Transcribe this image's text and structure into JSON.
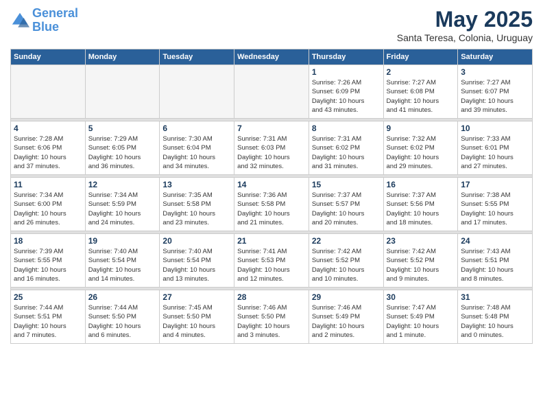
{
  "logo": {
    "line1": "General",
    "line2": "Blue"
  },
  "title": "May 2025",
  "location": "Santa Teresa, Colonia, Uruguay",
  "weekdays": [
    "Sunday",
    "Monday",
    "Tuesday",
    "Wednesday",
    "Thursday",
    "Friday",
    "Saturday"
  ],
  "weeks": [
    [
      {
        "day": "",
        "info": ""
      },
      {
        "day": "",
        "info": ""
      },
      {
        "day": "",
        "info": ""
      },
      {
        "day": "",
        "info": ""
      },
      {
        "day": "1",
        "info": "Sunrise: 7:26 AM\nSunset: 6:09 PM\nDaylight: 10 hours\nand 43 minutes."
      },
      {
        "day": "2",
        "info": "Sunrise: 7:27 AM\nSunset: 6:08 PM\nDaylight: 10 hours\nand 41 minutes."
      },
      {
        "day": "3",
        "info": "Sunrise: 7:27 AM\nSunset: 6:07 PM\nDaylight: 10 hours\nand 39 minutes."
      }
    ],
    [
      {
        "day": "4",
        "info": "Sunrise: 7:28 AM\nSunset: 6:06 PM\nDaylight: 10 hours\nand 37 minutes."
      },
      {
        "day": "5",
        "info": "Sunrise: 7:29 AM\nSunset: 6:05 PM\nDaylight: 10 hours\nand 36 minutes."
      },
      {
        "day": "6",
        "info": "Sunrise: 7:30 AM\nSunset: 6:04 PM\nDaylight: 10 hours\nand 34 minutes."
      },
      {
        "day": "7",
        "info": "Sunrise: 7:31 AM\nSunset: 6:03 PM\nDaylight: 10 hours\nand 32 minutes."
      },
      {
        "day": "8",
        "info": "Sunrise: 7:31 AM\nSunset: 6:02 PM\nDaylight: 10 hours\nand 31 minutes."
      },
      {
        "day": "9",
        "info": "Sunrise: 7:32 AM\nSunset: 6:02 PM\nDaylight: 10 hours\nand 29 minutes."
      },
      {
        "day": "10",
        "info": "Sunrise: 7:33 AM\nSunset: 6:01 PM\nDaylight: 10 hours\nand 27 minutes."
      }
    ],
    [
      {
        "day": "11",
        "info": "Sunrise: 7:34 AM\nSunset: 6:00 PM\nDaylight: 10 hours\nand 26 minutes."
      },
      {
        "day": "12",
        "info": "Sunrise: 7:34 AM\nSunset: 5:59 PM\nDaylight: 10 hours\nand 24 minutes."
      },
      {
        "day": "13",
        "info": "Sunrise: 7:35 AM\nSunset: 5:58 PM\nDaylight: 10 hours\nand 23 minutes."
      },
      {
        "day": "14",
        "info": "Sunrise: 7:36 AM\nSunset: 5:58 PM\nDaylight: 10 hours\nand 21 minutes."
      },
      {
        "day": "15",
        "info": "Sunrise: 7:37 AM\nSunset: 5:57 PM\nDaylight: 10 hours\nand 20 minutes."
      },
      {
        "day": "16",
        "info": "Sunrise: 7:37 AM\nSunset: 5:56 PM\nDaylight: 10 hours\nand 18 minutes."
      },
      {
        "day": "17",
        "info": "Sunrise: 7:38 AM\nSunset: 5:55 PM\nDaylight: 10 hours\nand 17 minutes."
      }
    ],
    [
      {
        "day": "18",
        "info": "Sunrise: 7:39 AM\nSunset: 5:55 PM\nDaylight: 10 hours\nand 16 minutes."
      },
      {
        "day": "19",
        "info": "Sunrise: 7:40 AM\nSunset: 5:54 PM\nDaylight: 10 hours\nand 14 minutes."
      },
      {
        "day": "20",
        "info": "Sunrise: 7:40 AM\nSunset: 5:54 PM\nDaylight: 10 hours\nand 13 minutes."
      },
      {
        "day": "21",
        "info": "Sunrise: 7:41 AM\nSunset: 5:53 PM\nDaylight: 10 hours\nand 12 minutes."
      },
      {
        "day": "22",
        "info": "Sunrise: 7:42 AM\nSunset: 5:52 PM\nDaylight: 10 hours\nand 10 minutes."
      },
      {
        "day": "23",
        "info": "Sunrise: 7:42 AM\nSunset: 5:52 PM\nDaylight: 10 hours\nand 9 minutes."
      },
      {
        "day": "24",
        "info": "Sunrise: 7:43 AM\nSunset: 5:51 PM\nDaylight: 10 hours\nand 8 minutes."
      }
    ],
    [
      {
        "day": "25",
        "info": "Sunrise: 7:44 AM\nSunset: 5:51 PM\nDaylight: 10 hours\nand 7 minutes."
      },
      {
        "day": "26",
        "info": "Sunrise: 7:44 AM\nSunset: 5:50 PM\nDaylight: 10 hours\nand 6 minutes."
      },
      {
        "day": "27",
        "info": "Sunrise: 7:45 AM\nSunset: 5:50 PM\nDaylight: 10 hours\nand 4 minutes."
      },
      {
        "day": "28",
        "info": "Sunrise: 7:46 AM\nSunset: 5:50 PM\nDaylight: 10 hours\nand 3 minutes."
      },
      {
        "day": "29",
        "info": "Sunrise: 7:46 AM\nSunset: 5:49 PM\nDaylight: 10 hours\nand 2 minutes."
      },
      {
        "day": "30",
        "info": "Sunrise: 7:47 AM\nSunset: 5:49 PM\nDaylight: 10 hours\nand 1 minute."
      },
      {
        "day": "31",
        "info": "Sunrise: 7:48 AM\nSunset: 5:48 PM\nDaylight: 10 hours\nand 0 minutes."
      }
    ]
  ]
}
